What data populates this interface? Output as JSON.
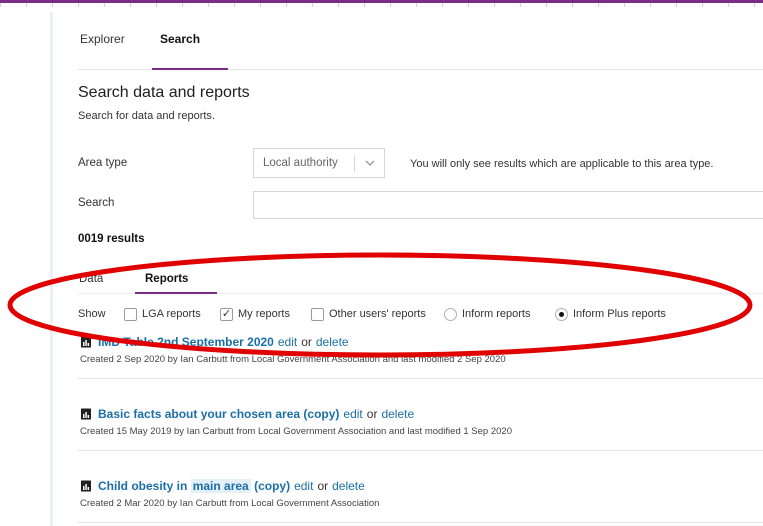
{
  "nav": {
    "tabs": [
      {
        "label": "Explorer",
        "active": false
      },
      {
        "label": "Search",
        "active": true
      }
    ]
  },
  "page": {
    "title": "Search data and reports",
    "subtitle": "Search for data and reports."
  },
  "area_type": {
    "label": "Area type",
    "selected": "Local authority",
    "hint": "You will only see results which are applicable to this area type."
  },
  "search": {
    "label": "Search",
    "value": ""
  },
  "results": {
    "count_text": "0019 results"
  },
  "result_tabs": [
    {
      "label": "Data",
      "active": false
    },
    {
      "label": "Reports",
      "active": true
    }
  ],
  "filters": {
    "show_label": "Show",
    "options": [
      {
        "label": "LGA reports",
        "kind": "checkbox",
        "checked": false
      },
      {
        "label": "My reports",
        "kind": "checkbox",
        "checked": true
      },
      {
        "label": "Other users' reports",
        "kind": "checkbox",
        "checked": false
      },
      {
        "label": "Inform reports",
        "kind": "radio",
        "checked": false
      },
      {
        "label": "Inform Plus reports",
        "kind": "radio",
        "checked": true
      }
    ]
  },
  "reports": [
    {
      "name": "IMD Table 2nd September 2020",
      "edit": "edit",
      "or": "or",
      "delete": "delete",
      "meta": "Created 2 Sep 2020 by Ian Carbutt from Local Government Association and last modified 2 Sep 2020"
    },
    {
      "name": "Basic facts about your chosen area (copy)",
      "edit": "edit",
      "or": "or",
      "delete": "delete",
      "meta": "Created 15 May 2019 by Ian Carbutt from Local Government Association and last modified 1 Sep 2020"
    },
    {
      "name_part1": "Child obesity in",
      "name_part2": "main area",
      "name_part3": "(copy)",
      "edit": "edit",
      "or": "or",
      "delete": "delete",
      "meta": "Created 2 Mar 2020 by Ian Carbutt from Local Government Association"
    }
  ],
  "colors": {
    "brand": "#7b2c87",
    "link": "#1b6fa8",
    "annotation": "#e00000"
  }
}
